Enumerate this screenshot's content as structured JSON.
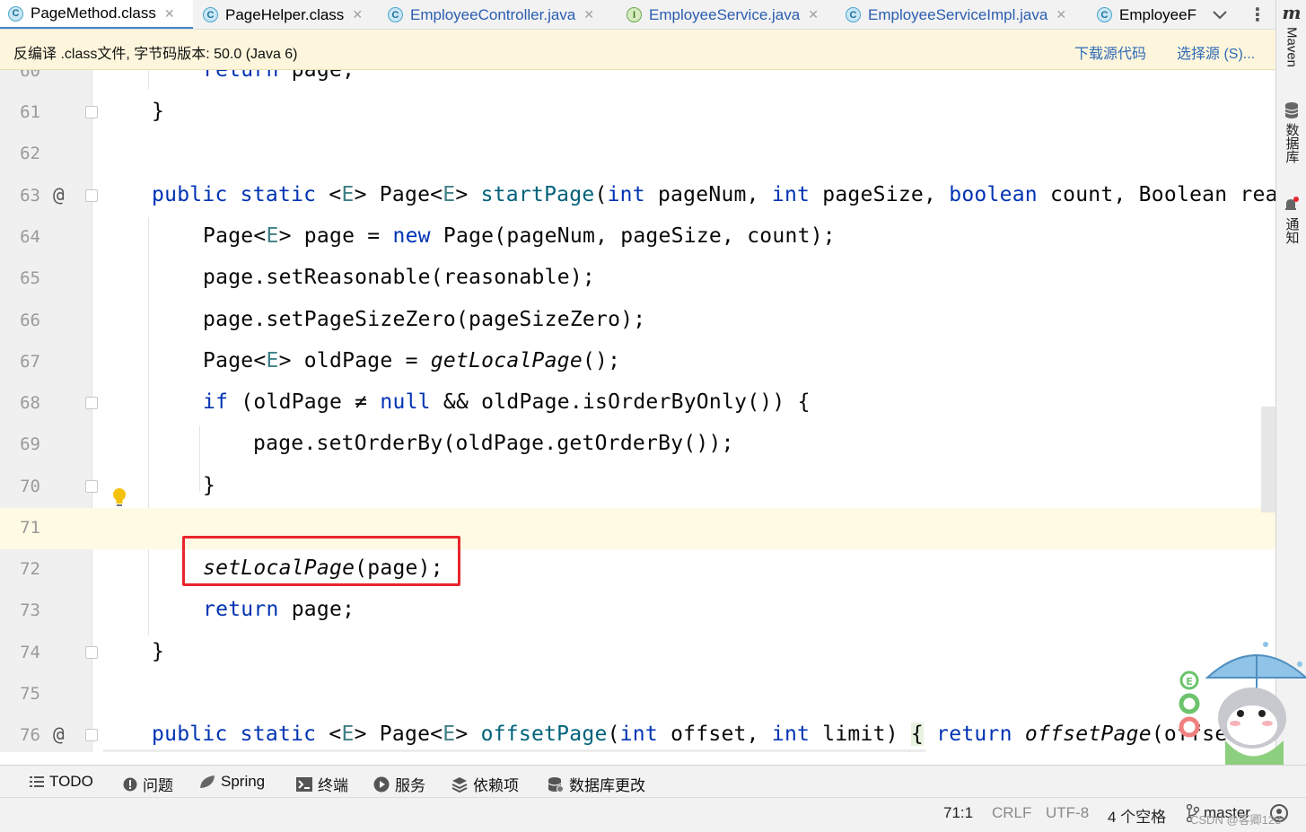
{
  "tabs": [
    {
      "label": "PageMethod.class",
      "icon": "class-icon",
      "letter": "C",
      "active": true
    },
    {
      "label": "PageHelper.class",
      "icon": "class-icon",
      "letter": "C",
      "active": false
    },
    {
      "label": "EmployeeController.java",
      "icon": "class-icon",
      "letter": "C",
      "active": false
    },
    {
      "label": "EmployeeService.java",
      "icon": "interface-icon",
      "letter": "I",
      "active": false
    },
    {
      "label": "EmployeeServiceImpl.java",
      "icon": "class-icon",
      "letter": "C",
      "active": false
    },
    {
      "label": "EmployeeF",
      "icon": "class-icon",
      "letter": "C",
      "active": false
    }
  ],
  "banner": {
    "text": "反编译 .class文件, 字节码版本: 50.0 (Java 6)",
    "download_link": "下载源代码",
    "choose_source_link": "选择源 (S)..."
  },
  "right_stripe": {
    "maven": "Maven",
    "database": "数据库",
    "notifications": "通知"
  },
  "code_lines": [
    {
      "num": "60",
      "text": "return page;"
    },
    {
      "num": "61",
      "text": "}"
    },
    {
      "num": "62",
      "text": ""
    },
    {
      "num": "63",
      "text": "public static <E> Page<E> startPage(int pageNum, int pageSize, boolean count, Boolean reas"
    },
    {
      "num": "64",
      "text": "Page<E> page = new Page(pageNum, pageSize, count);"
    },
    {
      "num": "65",
      "text": "page.setReasonable(reasonable);"
    },
    {
      "num": "66",
      "text": "page.setPageSizeZero(pageSizeZero);"
    },
    {
      "num": "67",
      "text": "Page<E> oldPage = getLocalPage();"
    },
    {
      "num": "68",
      "text": "if (oldPage ≠ null && oldPage.isOrderByOnly()) {"
    },
    {
      "num": "69",
      "text": "page.setOrderBy(oldPage.getOrderBy());"
    },
    {
      "num": "70",
      "text": "}"
    },
    {
      "num": "71",
      "text": ""
    },
    {
      "num": "72",
      "text": "setLocalPage(page);"
    },
    {
      "num": "73",
      "text": "return page;"
    },
    {
      "num": "74",
      "text": "}"
    },
    {
      "num": "75",
      "text": ""
    },
    {
      "num": "76",
      "text": "public static <E> Page<E> offsetPage(int offset, int limit) { return offsetPage(offset"
    }
  ],
  "tool_windows": [
    {
      "label": "TODO",
      "icon": "list-icon"
    },
    {
      "label": "问题",
      "icon": "problems-icon"
    },
    {
      "label": "Spring",
      "icon": "spring-icon"
    },
    {
      "label": "终端",
      "icon": "terminal-icon"
    },
    {
      "label": "服务",
      "icon": "services-icon"
    },
    {
      "label": "依赖项",
      "icon": "dependencies-icon"
    },
    {
      "label": "数据库更改",
      "icon": "database-changes-icon"
    }
  ],
  "status": {
    "position": "71:1",
    "line_separator": "CRLF",
    "encoding": "UTF-8",
    "indent": "4 个空格",
    "branch": "master"
  },
  "watermark": "CSDN @客卿123",
  "colors": {
    "keyword": "#0033b3",
    "method": "#00627a",
    "highlight_box": "#e8262d",
    "caret_row": "#fffae3",
    "banner": "#fdf6dc",
    "link": "#2f6bb8"
  }
}
